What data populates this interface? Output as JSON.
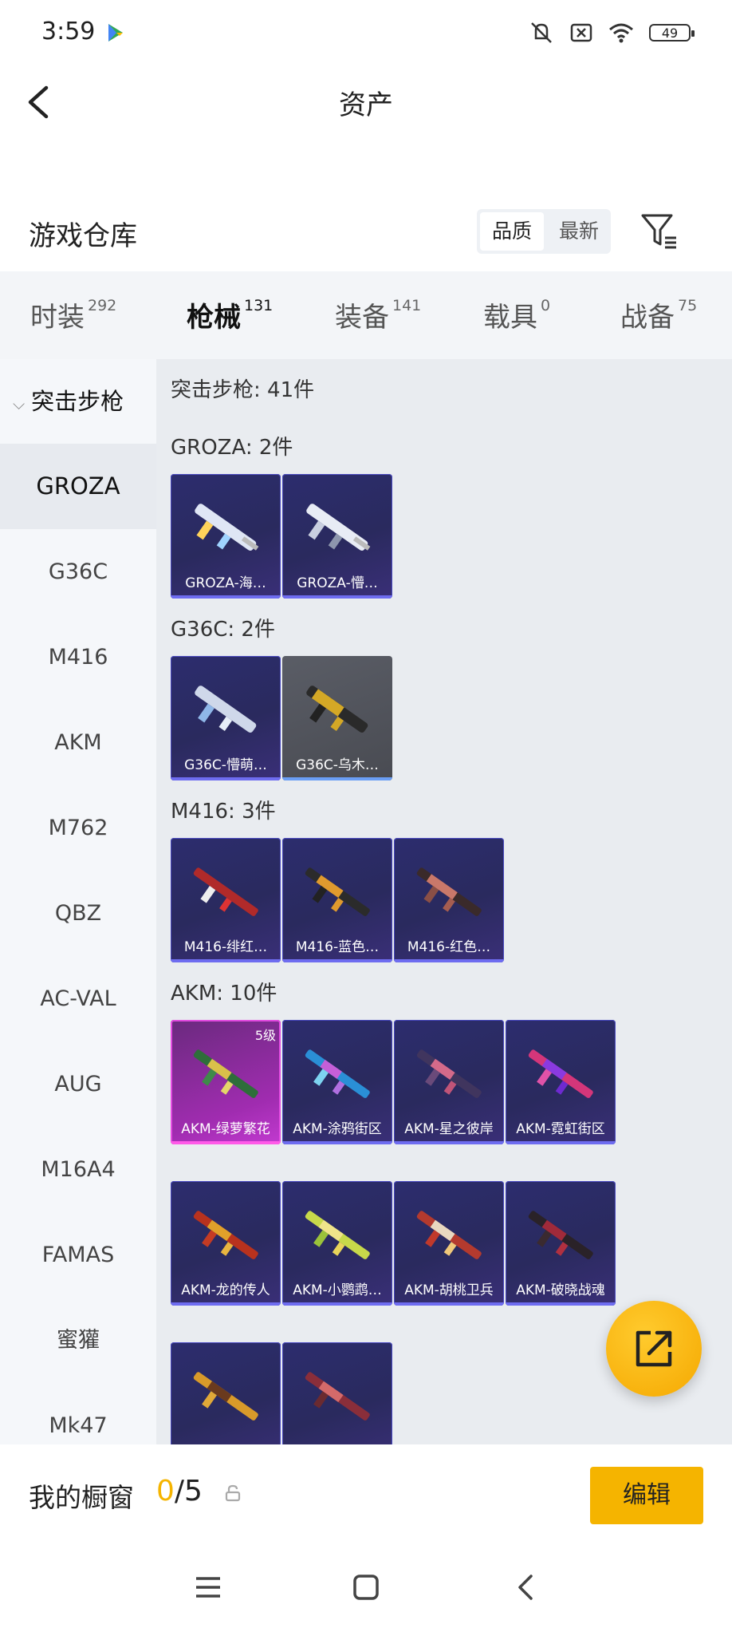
{
  "status_bar": {
    "time": "3:59",
    "battery": "49"
  },
  "header": {
    "title": "资产"
  },
  "warehouse": {
    "title": "游戏仓库",
    "sort_options": [
      "品质",
      "最新"
    ]
  },
  "tabs": [
    {
      "label": "时装",
      "count": "292"
    },
    {
      "label": "枪械",
      "count": "131"
    },
    {
      "label": "装备",
      "count": "141"
    },
    {
      "label": "载具",
      "count": "0"
    },
    {
      "label": "战备",
      "count": "75"
    }
  ],
  "sidebar": {
    "group": "突击步枪",
    "items": [
      "GROZA",
      "G36C",
      "M416",
      "AKM",
      "M762",
      "QBZ",
      "AC-VAL",
      "AUG",
      "M16A4",
      "FAMAS",
      "蜜獾",
      "Mk47"
    ]
  },
  "main": {
    "summary": "突击步枪: 41件",
    "sections": [
      {
        "title": "GROZA: 2件",
        "items": [
          "GROZA-海…",
          "GROZA-懵…"
        ]
      },
      {
        "title": "G36C: 2件",
        "items": [
          "G36C-懵萌…",
          "G36C-乌木…"
        ]
      },
      {
        "title": "M416: 3件",
        "items": [
          "M416-绯红…",
          "M416-蓝色…",
          "M416-红色…"
        ]
      },
      {
        "title": "AKM: 10件",
        "items": [
          "AKM-绿萝繁花",
          "AKM-涂鸦街区",
          "AKM-星之彼岸",
          "AKM-霓虹街区",
          "AKM-龙的传人",
          "AKM-小鹦鹉…",
          "AKM-胡桃卫兵",
          "AKM-破晓战魂",
          "",
          ""
        ]
      }
    ],
    "badge": "5级"
  },
  "showcase": {
    "title": "我的橱窗",
    "current": "0",
    "total": "/5",
    "edit_label": "编辑"
  },
  "colors": {
    "accent": "#f5b400",
    "card_bg": "#2a2a5e",
    "rare_pink": "#c23ad0"
  }
}
